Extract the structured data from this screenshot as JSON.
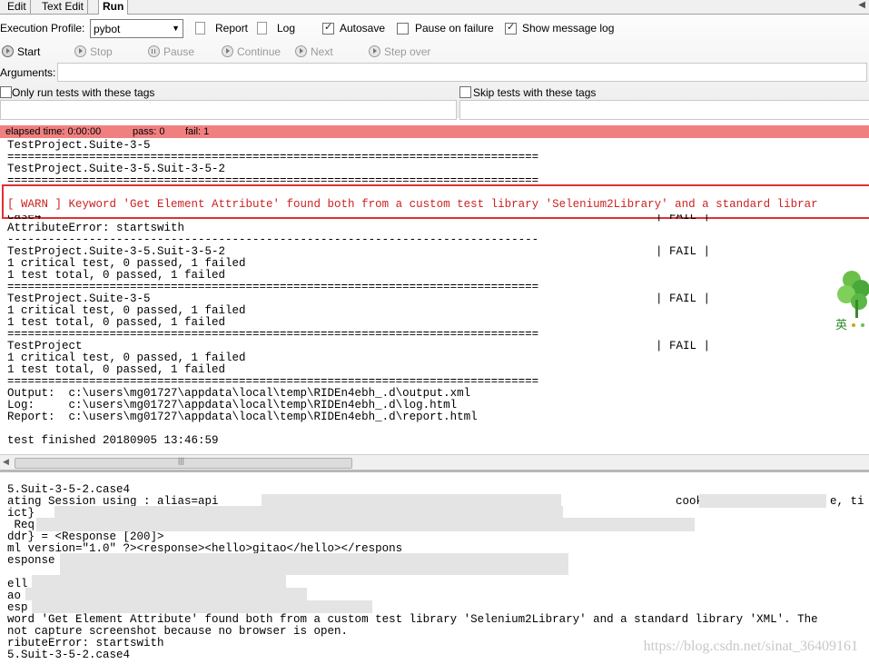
{
  "tabs": [
    {
      "label": "Edit",
      "active": false
    },
    {
      "label": "Text Edit",
      "active": false
    },
    {
      "label": "Run",
      "active": true
    }
  ],
  "toolbar": {
    "execution_profile_label": "Execution Profile:",
    "execution_profile_value": "pybot",
    "report_label": "Report",
    "log_label": "Log",
    "autosave_label": "Autosave",
    "autosave_checked": true,
    "pause_on_failure_label": "Pause on failure",
    "pause_on_failure_checked": false,
    "show_message_log_label": "Show message log",
    "show_message_log_checked": true,
    "start_label": "Start",
    "stop_label": "Stop",
    "pause_label": "Pause",
    "continue_label": "Continue",
    "next_label": "Next",
    "step_over_label": "Step over",
    "arguments_label": "Arguments:",
    "arguments_value": "",
    "only_run_tags_label": "Only run tests with these tags",
    "skip_tags_label": "Skip tests with these tags"
  },
  "status": {
    "elapsed": "elapsed time: 0:00:00",
    "pass": "pass: 0",
    "fail": "fail: 1",
    "color": "#f08080"
  },
  "output": {
    "lines": [
      "TestProject.Suite-3-5",
      "==============================================================================",
      "TestProject.Suite-3-5.Suit-3-5-2",
      "==============================================================================",
      "[ WARN ] Keyword 'Get Element Attribute' found both from a custom test library 'Selenium2Library' and a standard librar",
      "case4",
      "AttributeError: startswith",
      "------------------------------------------------------------------------------",
      "TestProject.Suite-3-5.Suit-3-5-2",
      "1 critical test, 0 passed, 1 failed",
      "1 test total, 0 passed, 1 failed",
      "==============================================================================",
      "TestProject.Suite-3-5",
      "1 critical test, 0 passed, 1 failed",
      "1 test total, 0 passed, 1 failed",
      "==============================================================================",
      "TestProject",
      "1 critical test, 0 passed, 1 failed",
      "1 test total, 0 passed, 1 failed",
      "==============================================================================",
      "Output:  c:\\users\\mg01727\\appdata\\local\\temp\\RIDEn4ebh_.d\\output.xml",
      "Log:     c:\\users\\mg01727\\appdata\\local\\temp\\RIDEn4ebh_.d\\log.html",
      "Report:  c:\\users\\mg01727\\appdata\\local\\temp\\RIDEn4ebh_.d\\report.html",
      "test finished 20180905 13:46:59"
    ],
    "fail_marks": [
      "| FAIL |",
      "| FAIL |",
      "| FAIL |",
      "| FAIL |"
    ]
  },
  "logo": {
    "text": "英"
  },
  "log": {
    "lines": [
      "5.Suit-3-5-2.case4",
      "ating Session using : alias=api",
      "cook",
      "e, ti",
      "ict}",
      " Req",
      "ddr} = <Response [200]>",
      "ml version=\"1.0\" ?><response><hello>gitao</hello></respons",
      "esponse",
      "ell",
      "ao",
      "esp",
      "word 'Get Element Attribute' found both from a custom test library 'Selenium2Library' and a standard library 'XML'. The",
      "not capture screenshot because no browser is open.",
      "ributeError: startswith",
      "5.Suit-3-5-2.case4"
    ],
    "watermark": "https://blog.csdn.net/sinat_36409161"
  }
}
